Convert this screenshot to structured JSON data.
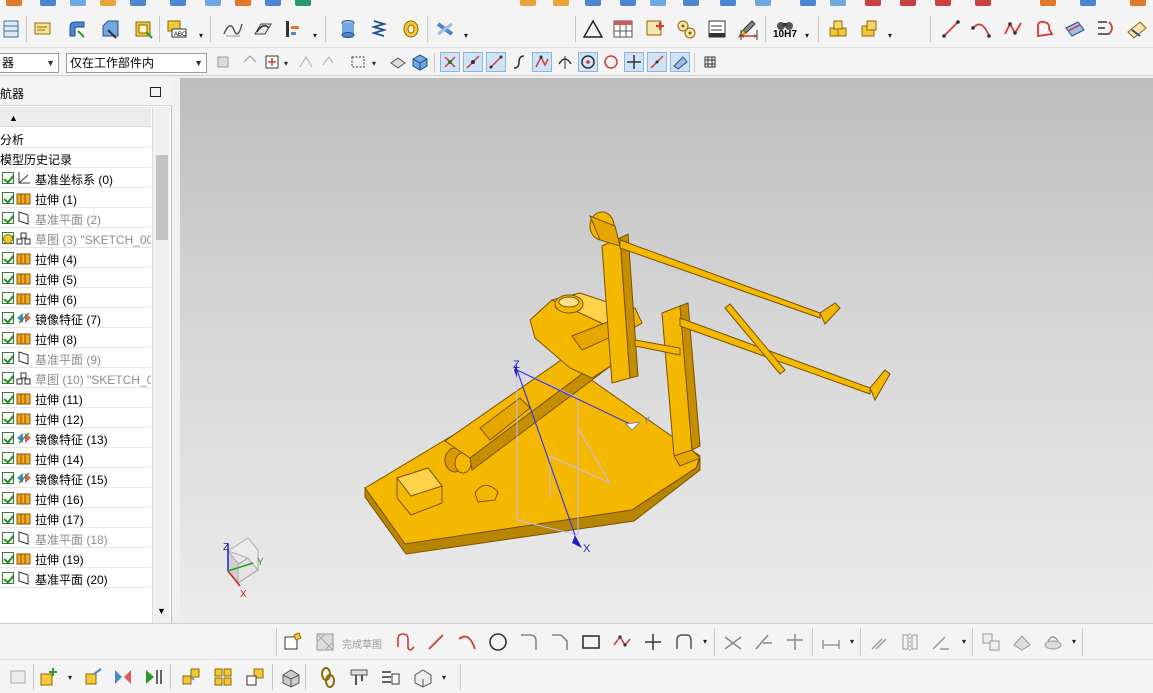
{
  "toolbar_main": {
    "tools": [
      {
        "icon": "datum-table-icon"
      },
      {
        "icon": "note-icon"
      },
      {
        "icon": "edge-blend-icon"
      },
      {
        "icon": "chamfer-icon"
      },
      {
        "icon": "shell-icon"
      },
      {
        "icon": "pmi-text-icon"
      },
      {
        "icon": "curve-on-surface-icon"
      },
      {
        "icon": "extract-curve-icon"
      },
      {
        "icon": "offset-curve-icon"
      },
      {
        "icon": "cylinder-icon"
      },
      {
        "icon": "spring-icon"
      },
      {
        "icon": "thread-icon"
      },
      {
        "icon": "pipe-icon"
      },
      {
        "icon": "triangle-icon"
      },
      {
        "icon": "table-icon"
      },
      {
        "icon": "grid-edit-icon"
      },
      {
        "icon": "gear-icon"
      },
      {
        "icon": "drawing-sheet-icon"
      },
      {
        "icon": "brush-icon"
      },
      {
        "icon": "dimension-icon"
      },
      {
        "icon": "binoculars-icon"
      },
      {
        "icon": "fit-tolerance-icon"
      },
      {
        "icon": "assembly-icon"
      },
      {
        "icon": "component-icon"
      },
      {
        "icon": "line-icon"
      },
      {
        "icon": "arc-icon"
      },
      {
        "icon": "studio-spline-icon"
      },
      {
        "icon": "freeform-icon"
      },
      {
        "icon": "surface-icon"
      },
      {
        "icon": "spline-icon"
      },
      {
        "icon": "extension-icon"
      }
    ],
    "fit_tolerance_label": "10H7"
  },
  "selection_bar": {
    "filter_value": "器",
    "scope_value": "仅在工作部件内"
  },
  "navigator": {
    "title": "航器",
    "header_rows": [
      "分析",
      "模型历史记录"
    ],
    "features": [
      {
        "label": "基准坐标系 (0)",
        "type": "datum-csys",
        "dim": false
      },
      {
        "label": "拉伸 (1)",
        "type": "extrude",
        "dim": false
      },
      {
        "label": "基准平面 (2)",
        "type": "datum-plane",
        "dim": true
      },
      {
        "label": "草图 (3) \"SKETCH_00",
        "type": "sketch-warning",
        "dim": true
      },
      {
        "label": "拉伸 (4)",
        "type": "extrude",
        "dim": false
      },
      {
        "label": "拉伸 (5)",
        "type": "extrude",
        "dim": false
      },
      {
        "label": "拉伸 (6)",
        "type": "extrude",
        "dim": false
      },
      {
        "label": "镜像特征 (7)",
        "type": "mirror",
        "dim": false
      },
      {
        "label": "拉伸 (8)",
        "type": "extrude",
        "dim": false
      },
      {
        "label": "基准平面 (9)",
        "type": "datum-plane",
        "dim": true
      },
      {
        "label": "草图 (10) \"SKETCH_0",
        "type": "sketch",
        "dim": true
      },
      {
        "label": "拉伸 (11)",
        "type": "extrude",
        "dim": false
      },
      {
        "label": "拉伸 (12)",
        "type": "extrude",
        "dim": false
      },
      {
        "label": "镜像特征 (13)",
        "type": "mirror",
        "dim": false
      },
      {
        "label": "拉伸 (14)",
        "type": "extrude",
        "dim": false
      },
      {
        "label": "镜像特征 (15)",
        "type": "mirror",
        "dim": false
      },
      {
        "label": "拉伸 (16)",
        "type": "extrude",
        "dim": false
      },
      {
        "label": "拉伸 (17)",
        "type": "extrude",
        "dim": false
      },
      {
        "label": "基准平面 (18)",
        "type": "datum-plane",
        "dim": true
      },
      {
        "label": "拉伸 (19)",
        "type": "extrude",
        "dim": false
      },
      {
        "label": "基准平面 (20)",
        "type": "datum-plane",
        "dim": false
      }
    ]
  },
  "viewport": {
    "axis_labels": {
      "x": "X",
      "y": "Y",
      "z": "Z"
    },
    "triad_labels": {
      "x": "X",
      "y": "Y",
      "z": "Z"
    },
    "model_color": "#f5b800",
    "model_edge_color": "#7a5200"
  },
  "sketch_toolbar": {
    "finish_sketch_label": "完成草图"
  },
  "colors": {
    "accent_green": "#1c8b1c",
    "selection_blue": "#cfe3f5"
  }
}
